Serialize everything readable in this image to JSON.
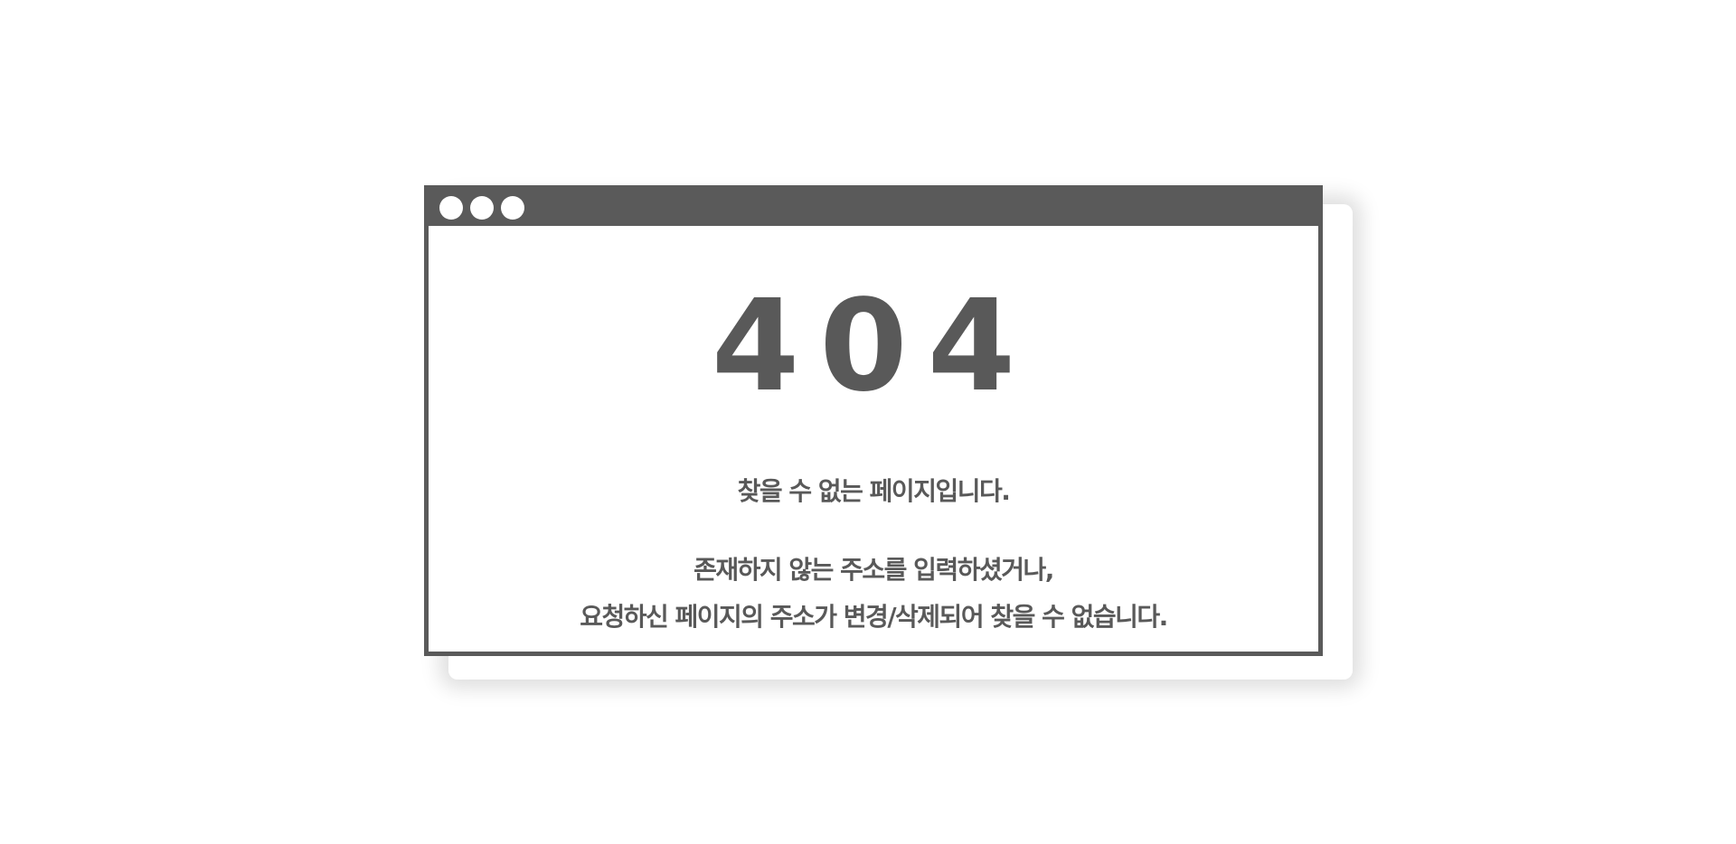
{
  "window": {
    "titlebar_dots": [
      "dot",
      "dot",
      "dot"
    ]
  },
  "error": {
    "code": "404",
    "headline": "찾을 수 없는 페이지입니다.",
    "description_line1": "존재하지 않는 주소를 입력하셨거나,",
    "description_line2": "요청하신 페이지의 주소가 변경/삭제되어 찾을 수 없습니다."
  },
  "colors": {
    "frame": "#5a5a5a",
    "text": "#595959",
    "background": "#ffffff"
  }
}
